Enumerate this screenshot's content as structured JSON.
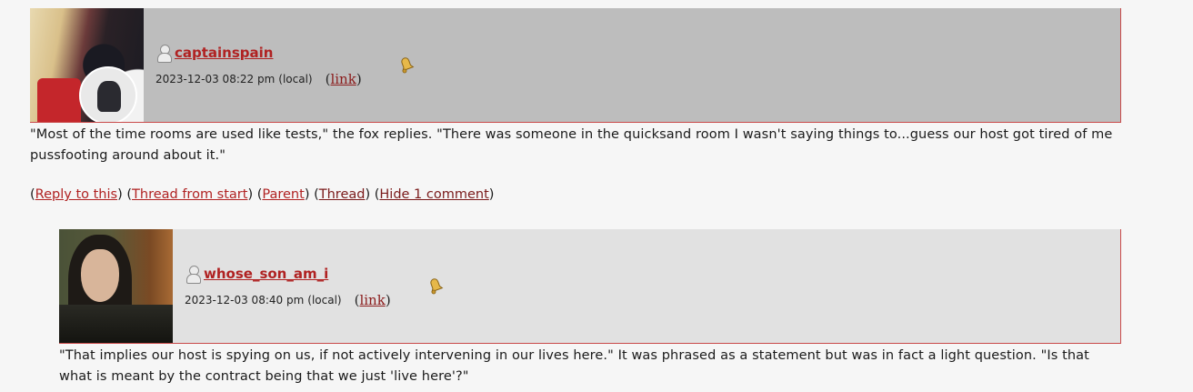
{
  "comments": [
    {
      "username": "captainspain",
      "date": "2023-12-03 08:22 pm",
      "tz": "(local)",
      "link_open": "(",
      "link_label": "link",
      "link_close": ")",
      "body": "\"Most of the time rooms are used like tests,\" the fox replies. \"There was someone in the quicksand room I wasn't saying things to...guess our host got tired of me pussfooting around about it.\"",
      "actions": {
        "reply": "Reply to this",
        "thread_start": "Thread from start",
        "parent": "Parent",
        "thread": "Thread",
        "hide": "Hide 1 comment"
      }
    },
    {
      "username": "whose_son_am_i",
      "date": "2023-12-03 08:40 pm",
      "tz": "(local)",
      "link_open": "(",
      "link_label": "link",
      "link_close": ")",
      "body": "\"That implies our host is spying on us, if not actively intervening in our lives here.\" It was phrased as a statement but was in fact a light question. \"Is that what is meant by the contract being that we just 'live here'?\""
    }
  ],
  "colors": {
    "header_1": "#bdbdbd",
    "header_2": "#e1e1e1",
    "border": "#c94a4a",
    "link": "#b02222",
    "background": "#f6f6f6"
  },
  "icons": [
    "user-icon",
    "bell-icon"
  ]
}
